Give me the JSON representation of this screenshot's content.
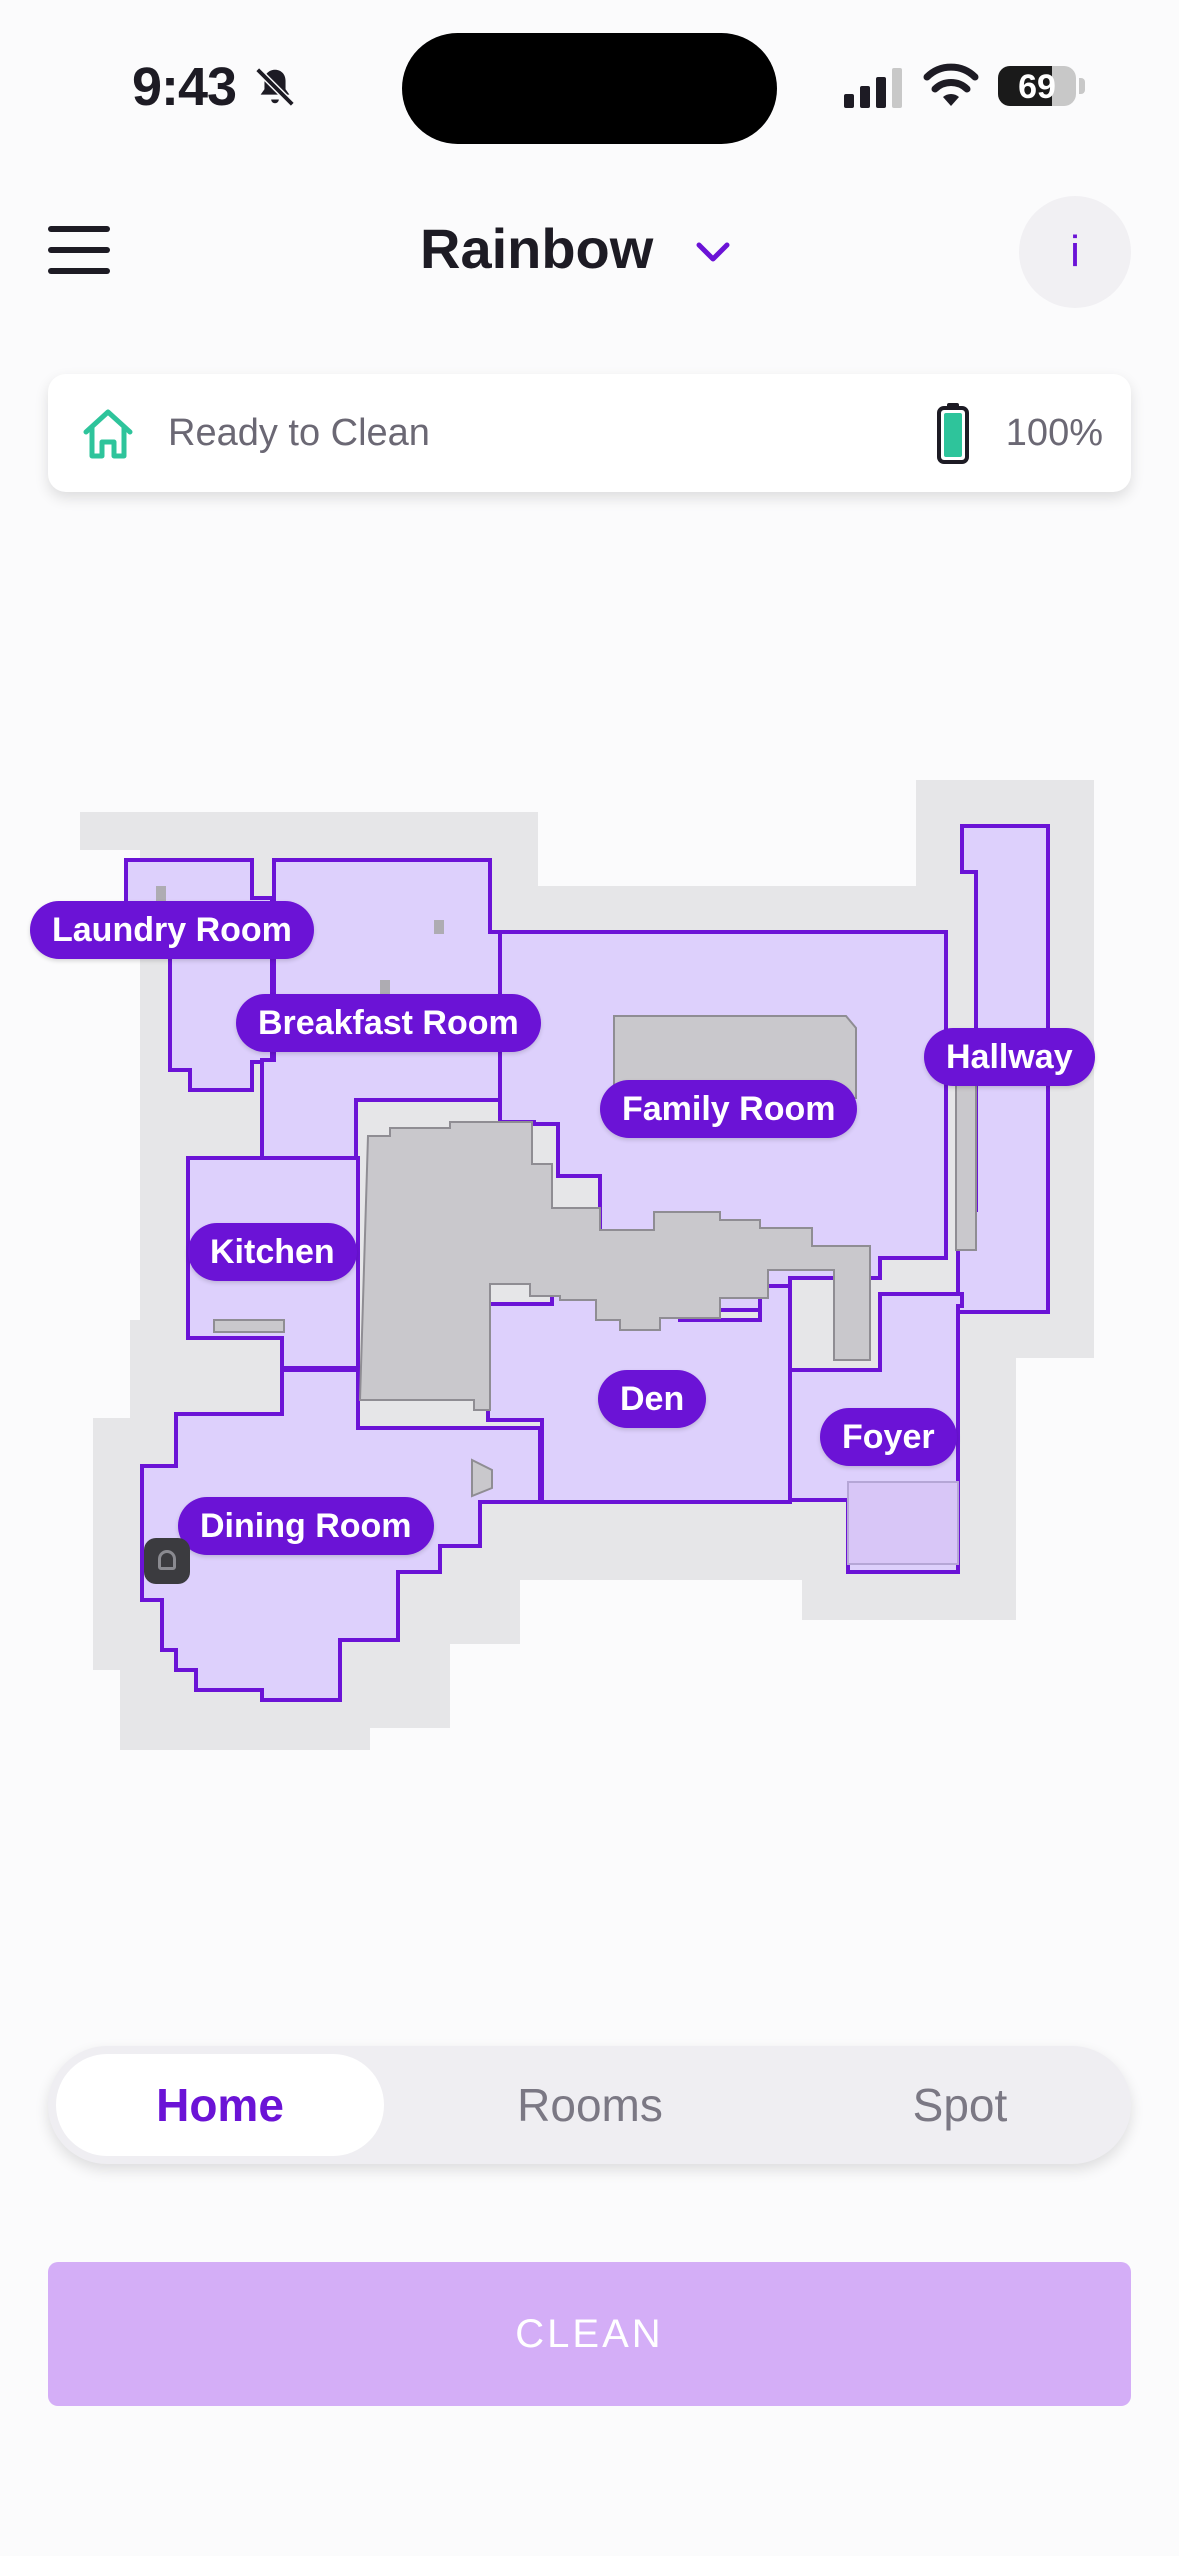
{
  "status_bar": {
    "time": "9:43",
    "battery": "69",
    "battery_level": 0.69
  },
  "header": {
    "title": "Rainbow"
  },
  "status_card": {
    "status": "Ready to Clean",
    "battery": "100%"
  },
  "map": {
    "rooms": [
      "Laundry Room",
      "Breakfast Room",
      "Family Room",
      "Hallway",
      "Kitchen",
      "Den",
      "Foyer",
      "Dining Room"
    ]
  },
  "tabs": [
    {
      "label": "Home",
      "active": true
    },
    {
      "label": "Rooms",
      "active": false
    },
    {
      "label": "Spot",
      "active": false
    }
  ],
  "actions": {
    "clean_label": "CLEAN"
  },
  "colors": {
    "accent": "#6b13d6",
    "room_fill": "#ddd0fc",
    "clean_button": "#d4aef7",
    "home_icon": "#2ec49b"
  }
}
